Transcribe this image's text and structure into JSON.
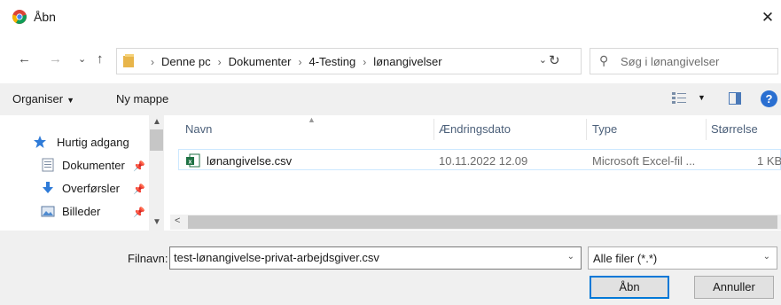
{
  "window": {
    "title": "Åbn",
    "close_glyph": "✕"
  },
  "nav": {
    "back_glyph": "←",
    "forward_glyph": "→",
    "recent_glyph": "⌄",
    "up_glyph": "↑"
  },
  "address": {
    "breadcrumbs": [
      "Denne pc",
      "Dokumenter",
      "4-Testing",
      "lønangivelser"
    ],
    "separator": "›",
    "dropdown_glyph": "⌄",
    "refresh_glyph": "↻"
  },
  "search": {
    "placeholder": "Søg i lønangivelser",
    "icon_glyph": "⚲"
  },
  "toolbar": {
    "organize_label": "Organiser",
    "organize_dd": "▼",
    "new_folder_label": "Ny mappe",
    "view_dd": "▼",
    "help_label": "?"
  },
  "sidebar": {
    "items": [
      {
        "label": "Hurtig adgang",
        "icon": "star-icon",
        "pinned": false
      },
      {
        "label": "Dokumenter",
        "icon": "documents-icon",
        "pinned": true
      },
      {
        "label": "Overførsler",
        "icon": "download-icon",
        "pinned": true
      },
      {
        "label": "Billeder",
        "icon": "pictures-icon",
        "pinned": true
      }
    ],
    "pin_glyph": "📌",
    "scroll_up": "▲",
    "scroll_down": "▼"
  },
  "filelist": {
    "columns": {
      "name": "Navn",
      "date": "Ændringsdato",
      "type": "Type",
      "size": "Størrelse"
    },
    "sort_indicator": "▲",
    "rows": [
      {
        "name": "lønangivelse.csv",
        "date": "10.11.2022 12.09",
        "type": "Microsoft Excel-fil ...",
        "size": "1 KB"
      }
    ],
    "hscroll_arrow": "<"
  },
  "footer": {
    "filename_label": "Filnavn:",
    "filename_value": "test-lønangivelse-privat-arbejdsgiver.csv",
    "filter_value": "Alle filer (*.*)",
    "dropdown_glyph": "⌄",
    "open_label": "Åbn",
    "cancel_label": "Annuller"
  },
  "colors": {
    "accent": "#0078d7",
    "selection_border": "#cce8ff",
    "toolbar_bg": "#f0f0f0",
    "excel_green": "#1f7244"
  }
}
